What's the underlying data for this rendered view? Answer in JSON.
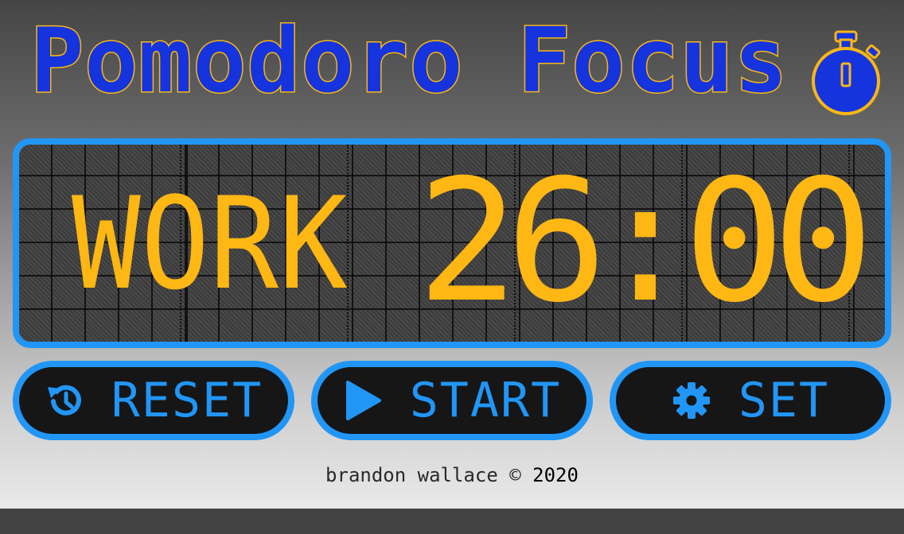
{
  "header": {
    "title": "Pomodoro Focus",
    "icon": "stopwatch-icon"
  },
  "display": {
    "mode": "WORK",
    "time": "26:00"
  },
  "controls": {
    "reset": {
      "label": "RESET",
      "icon": "history-icon"
    },
    "start": {
      "label": "START",
      "icon": "play-icon"
    },
    "set": {
      "label": "SET",
      "icon": "gear-icon"
    }
  },
  "footer": {
    "author": "brandon wallace ©",
    "year": "2020"
  },
  "colors": {
    "title_fill": "#1534de",
    "title_outline": "#f8b616",
    "display_text": "#ffb713",
    "accent": "#2196f7",
    "button_bg": "#161616"
  }
}
